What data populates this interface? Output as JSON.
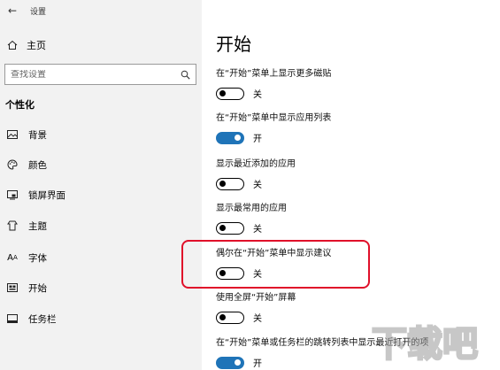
{
  "window": {
    "title": "设置"
  },
  "sidebar": {
    "home_label": "主页",
    "search_placeholder": "查找设置",
    "section_title": "个性化",
    "items": [
      {
        "label": "背景",
        "icon": "image-icon"
      },
      {
        "label": "颜色",
        "icon": "palette-icon"
      },
      {
        "label": "锁屏界面",
        "icon": "lock-screen-icon"
      },
      {
        "label": "主题",
        "icon": "theme-icon"
      },
      {
        "label": "字体",
        "icon": "font-icon"
      },
      {
        "label": "开始",
        "icon": "start-icon"
      },
      {
        "label": "任务栏",
        "icon": "taskbar-icon"
      }
    ]
  },
  "main": {
    "title": "开始",
    "settings": [
      {
        "desc": "在“开始”菜单上显示更多磁贴",
        "state": "关",
        "on": false
      },
      {
        "desc": "在“开始”菜单中显示应用列表",
        "state": "开",
        "on": true
      },
      {
        "desc": "显示最近添加的应用",
        "state": "关",
        "on": false
      },
      {
        "desc": "显示最常用的应用",
        "state": "关",
        "on": false
      },
      {
        "desc": "偶尔在“开始”菜单中显示建议",
        "state": "关",
        "on": false
      },
      {
        "desc": "使用全屏“开始”屏幕",
        "state": "关",
        "on": false
      },
      {
        "desc": "在“开始”菜单或任务栏的跳转列表中显示最近打开的项",
        "state": "开",
        "on": true
      }
    ]
  },
  "colors": {
    "accent": "#1f74b8",
    "highlight": "#e0102a"
  },
  "watermark": {
    "text": "下载吧"
  }
}
